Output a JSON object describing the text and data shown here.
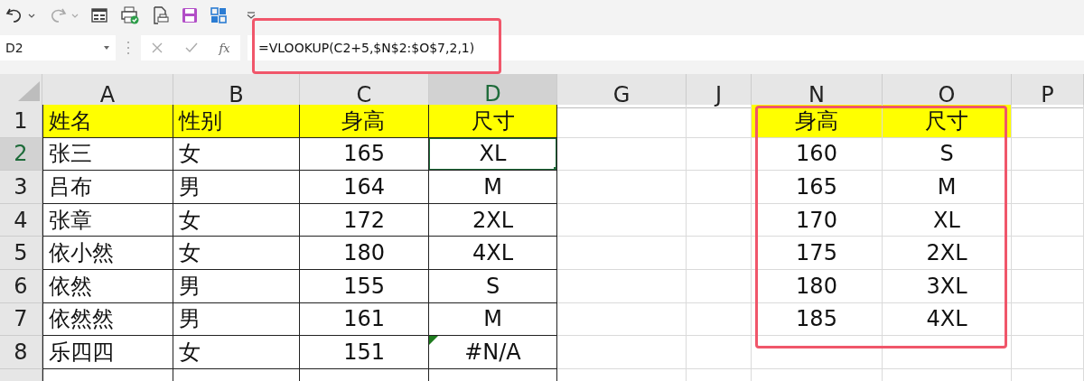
{
  "name_box": {
    "value": "D2"
  },
  "formula_bar": {
    "function_label": "fx",
    "formula": "=VLOOKUP(C2+5,$N$2:$O$7,2,1)"
  },
  "columns": [
    {
      "label": "A",
      "selected": false
    },
    {
      "label": "B",
      "selected": false
    },
    {
      "label": "C",
      "selected": false
    },
    {
      "label": "D",
      "selected": true
    },
    {
      "label": "G",
      "selected": false
    },
    {
      "label": "J",
      "selected": false
    },
    {
      "label": "N",
      "selected": false
    },
    {
      "label": "O",
      "selected": false
    },
    {
      "label": "P",
      "selected": false
    }
  ],
  "rows": [
    {
      "number": "1",
      "selected": false,
      "header": true,
      "error_flag": false,
      "table": [
        "姓名",
        "性别",
        "身高",
        "尺寸"
      ],
      "lookup": [
        "身高",
        "尺寸"
      ]
    },
    {
      "number": "2",
      "selected": true,
      "header": false,
      "error_flag": false,
      "table": [
        "张三",
        "女",
        "165",
        "XL"
      ],
      "lookup": [
        "160",
        "S"
      ]
    },
    {
      "number": "3",
      "selected": false,
      "header": false,
      "error_flag": false,
      "table": [
        "吕布",
        "男",
        "164",
        "M"
      ],
      "lookup": [
        "165",
        "M"
      ]
    },
    {
      "number": "4",
      "selected": false,
      "header": false,
      "error_flag": false,
      "table": [
        "张章",
        "女",
        "172",
        "2XL"
      ],
      "lookup": [
        "170",
        "XL"
      ]
    },
    {
      "number": "5",
      "selected": false,
      "header": false,
      "error_flag": false,
      "table": [
        "依小然",
        "女",
        "180",
        "4XL"
      ],
      "lookup": [
        "175",
        "2XL"
      ]
    },
    {
      "number": "6",
      "selected": false,
      "header": false,
      "error_flag": false,
      "table": [
        "依然",
        "男",
        "155",
        "S"
      ],
      "lookup": [
        "180",
        "3XL"
      ]
    },
    {
      "number": "7",
      "selected": false,
      "header": false,
      "error_flag": false,
      "table": [
        "依然然",
        "男",
        "161",
        "M"
      ],
      "lookup": [
        "185",
        "4XL"
      ]
    },
    {
      "number": "8",
      "selected": false,
      "header": false,
      "error_flag": true,
      "table": [
        "乐四四",
        "女",
        "151",
        "#N/A"
      ]
    }
  ]
}
